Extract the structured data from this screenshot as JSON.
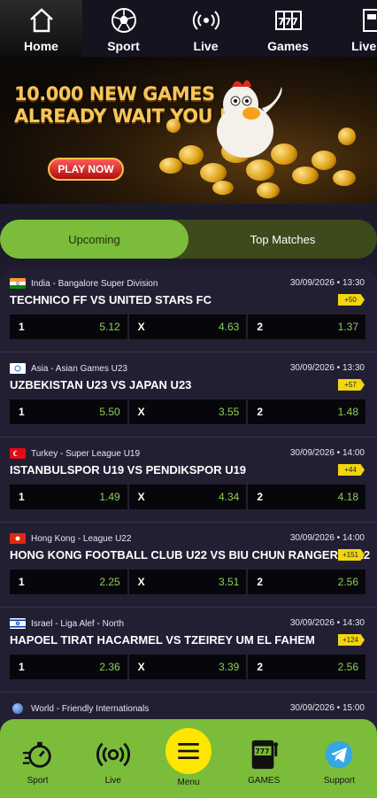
{
  "topnav": {
    "tabs": [
      {
        "label": "Home",
        "icon": "home-icon"
      },
      {
        "label": "Sport",
        "icon": "soccer-ball-icon"
      },
      {
        "label": "Live",
        "icon": "live-broadcast-icon"
      },
      {
        "label": "Games",
        "icon": "slot-machine-icon"
      },
      {
        "label": "Live G",
        "icon": "live-games-icon"
      }
    ]
  },
  "banner": {
    "line1": "10.000 NEW GAMES",
    "line2": "ALREADY WAIT YOU !!!",
    "play": "PLAY NOW"
  },
  "toggle": {
    "upcoming": "Upcoming",
    "top": "Top Matches"
  },
  "matches": [
    {
      "league": "India - Bangalore Super Division",
      "datetime": "30/09/2026 • 13:30",
      "teams": "TECHNICO FF VS UNITED STARS FC",
      "more": "+50",
      "o1": "5.12",
      "ox": "4.63",
      "o2": "1.37",
      "flag": "india"
    },
    {
      "league": "Asia - Asian Games U23",
      "datetime": "30/09/2026 • 13:30",
      "teams": "UZBEKISTAN U23 VS JAPAN U23",
      "more": "+57",
      "o1": "5.50",
      "ox": "3.55",
      "o2": "1.48",
      "flag": "asia"
    },
    {
      "league": "Turkey - Super League U19",
      "datetime": "30/09/2026 • 14:00",
      "teams": "ISTANBULSPOR U19 VS PENDIKSPOR U19",
      "more": "+44",
      "o1": "1.49",
      "ox": "4.34",
      "o2": "4.18",
      "flag": "turkey"
    },
    {
      "league": "Hong Kong - League U22",
      "datetime": "30/09/2026 • 14:00",
      "teams": "HONG KONG FOOTBALL CLUB U22 VS BIU CHUN RANGERS U22",
      "more": "+151",
      "o1": "2.25",
      "ox": "3.51",
      "o2": "2.56",
      "flag": "hongkong"
    },
    {
      "league": "Israel - Liga Alef - North",
      "datetime": "30/09/2026 • 14:30",
      "teams": "HAPOEL TIRAT HACARMEL VS TZEIREY UM EL FAHEM",
      "more": "+124",
      "o1": "2.36",
      "ox": "3.39",
      "o2": "2.56",
      "flag": "israel"
    },
    {
      "league": "World - Friendly Internationals",
      "datetime": "30/09/2026 • 15:00",
      "teams": "",
      "more": "",
      "o1": "",
      "ox": "",
      "o2": "",
      "flag": "world"
    }
  ],
  "odds_labels": {
    "home": "1",
    "draw": "X",
    "away": "2"
  },
  "bottomnav": {
    "sport": "Sport",
    "live": "Live",
    "menu": "Menu",
    "games": "GAMES",
    "support": "Support"
  },
  "colors": {
    "accent": "#7bbd3a",
    "badge": "#f2d60f",
    "menu_circle": "#ffe600",
    "odds_value": "#8cd055"
  }
}
